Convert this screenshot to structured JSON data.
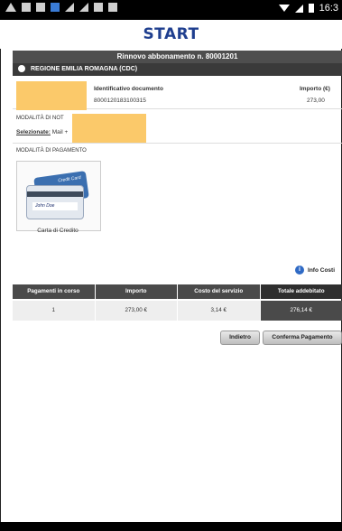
{
  "status_bar": {
    "time": "16:3",
    "left_icons": [
      "warning-icon",
      "image-icon",
      "image-icon",
      "app-icon",
      "signal-icon",
      "signal-icon",
      "image-icon",
      "image-icon"
    ]
  },
  "logo": {
    "text": "START"
  },
  "header": {
    "title": "Rinnovo abbonamento n. 80001201",
    "region": "REGIONE EMILIA ROMAGNA (CDC)"
  },
  "document": {
    "col_id_label": "Identificativo documento",
    "col_amount_label": "Importo (€)",
    "id_value": "8000120183100315",
    "amount_value": "273,00"
  },
  "notifica": {
    "section_label": "MODALITÀ DI NOT",
    "selected_label": "Selezionate:",
    "selected_value": "Mail +"
  },
  "payment_methods": {
    "section_label": "MODALITÀ DI PAGAMENTO",
    "card_caption": "Carta di Credito",
    "card_brand_text": "Credit Card",
    "card_signature": "John Doe"
  },
  "info_costi": {
    "label": "Info Costi"
  },
  "payment_table": {
    "headers": [
      "Pagamenti in corso",
      "Importo",
      "Costo del servizio",
      "Totale addebitato"
    ],
    "row": [
      "1",
      "273,00 €",
      "3,14 €",
      "276,14 €"
    ]
  },
  "buttons": {
    "back": "Indietro",
    "confirm": "Conferma Pagamento"
  },
  "colors": {
    "title_bar": "#4e4e4e",
    "region_bar": "#3a3a3a",
    "redaction": "#fbc96a",
    "logo": "#1f3f8f"
  }
}
